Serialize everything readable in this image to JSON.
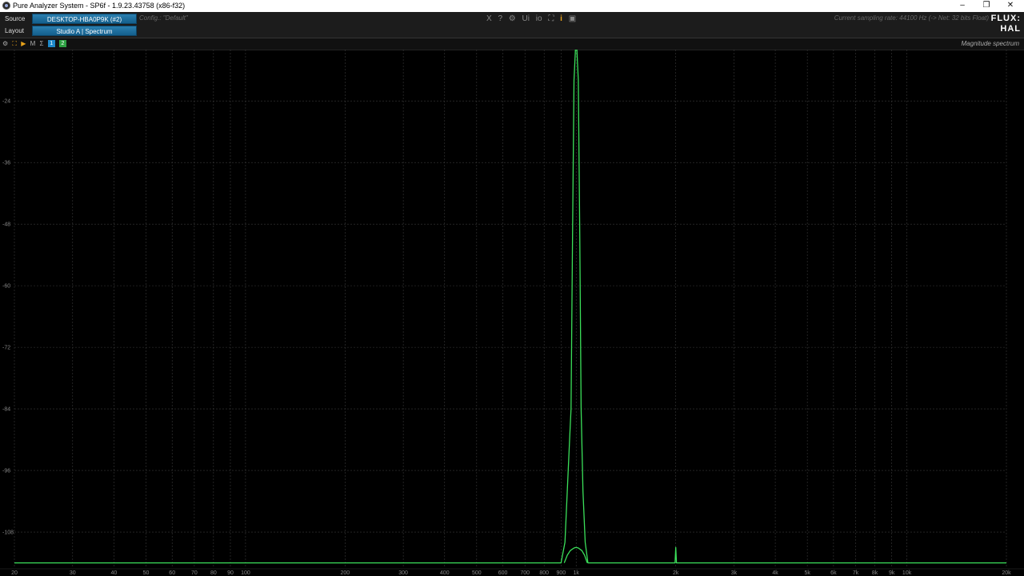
{
  "window": {
    "title": "Pure Analyzer System - SP6f - 1.9.23.43758 (x86-f32)",
    "controls": [
      "–",
      "❐",
      "✕"
    ]
  },
  "header": {
    "source_label": "Source",
    "source_value": "DESKTOP-HBA0P9K (#2)",
    "layout_label": "Layout",
    "layout_value": "Studio A | Spectrum",
    "config_text": "Config.: \"Default\"",
    "tools": [
      "X",
      "?",
      "⚙",
      "Ui",
      "io",
      "⛶",
      "i",
      "▣"
    ],
    "sampling_text": "Current sampling rate: 44100 Hz (-> Net: 32 bits Float)",
    "logo_top": "FLUX:",
    "logo_bottom": "HAL"
  },
  "subbar": {
    "tools": [
      "⚙",
      "⛶",
      "▶",
      "M",
      "Σ"
    ],
    "badges": [
      "1",
      "2"
    ],
    "badge_colors": [
      "#1e88c8",
      "#2ea043"
    ],
    "panel_title": "Magnitude spectrum"
  },
  "colors": {
    "trace": "#3be05a",
    "grid": "#3a3a3a",
    "accent_blue": "#1e6fa3"
  },
  "chart_data": {
    "type": "line",
    "x_scale": "log",
    "xlim": [
      20,
      20000
    ],
    "ylim": [
      -115,
      -14
    ],
    "y_ticks": [
      -24,
      -36,
      -48,
      -60,
      -72,
      -84,
      -96,
      -108
    ],
    "x_ticks": [
      {
        "v": 20,
        "label": "20"
      },
      {
        "v": 30,
        "label": "30"
      },
      {
        "v": 40,
        "label": "40"
      },
      {
        "v": 50,
        "label": "50"
      },
      {
        "v": 60,
        "label": "60"
      },
      {
        "v": 70,
        "label": "70"
      },
      {
        "v": 80,
        "label": "80"
      },
      {
        "v": 90,
        "label": "90"
      },
      {
        "v": 100,
        "label": "100"
      },
      {
        "v": 200,
        "label": "200"
      },
      {
        "v": 300,
        "label": "300"
      },
      {
        "v": 400,
        "label": "400"
      },
      {
        "v": 500,
        "label": "500"
      },
      {
        "v": 600,
        "label": "600"
      },
      {
        "v": 700,
        "label": "700"
      },
      {
        "v": 800,
        "label": "800"
      },
      {
        "v": 900,
        "label": "900"
      },
      {
        "v": 1000,
        "label": "1k"
      },
      {
        "v": 2000,
        "label": "2k"
      },
      {
        "v": 3000,
        "label": "3k"
      },
      {
        "v": 4000,
        "label": "4k"
      },
      {
        "v": 5000,
        "label": "5k"
      },
      {
        "v": 6000,
        "label": "6k"
      },
      {
        "v": 7000,
        "label": "7k"
      },
      {
        "v": 8000,
        "label": "8k"
      },
      {
        "v": 9000,
        "label": "9k"
      },
      {
        "v": 10000,
        "label": "10k"
      },
      {
        "v": 20000,
        "label": "20k"
      }
    ],
    "series": [
      {
        "values": [
          [
            20,
            -114
          ],
          [
            900,
            -114
          ],
          [
            925,
            -110
          ],
          [
            940,
            -100
          ],
          [
            955,
            -90
          ],
          [
            965,
            -84
          ],
          [
            975,
            -50
          ],
          [
            985,
            -20
          ],
          [
            995,
            -14
          ],
          [
            1005,
            -14
          ],
          [
            1015,
            -20
          ],
          [
            1025,
            -50
          ],
          [
            1035,
            -84
          ],
          [
            1048,
            -100
          ],
          [
            1065,
            -110
          ],
          [
            1085,
            -114
          ],
          [
            1990,
            -114
          ],
          [
            2000,
            -111
          ],
          [
            2010,
            -114
          ],
          [
            20000,
            -114
          ]
        ]
      },
      {
        "values": [
          [
            920,
            -114
          ],
          [
            940,
            -112.5
          ],
          [
            960,
            -111.6
          ],
          [
            985,
            -111.1
          ],
          [
            1000,
            -111
          ],
          [
            1015,
            -111.1
          ],
          [
            1040,
            -111.6
          ],
          [
            1060,
            -112.5
          ],
          [
            1080,
            -114
          ]
        ]
      }
    ]
  }
}
